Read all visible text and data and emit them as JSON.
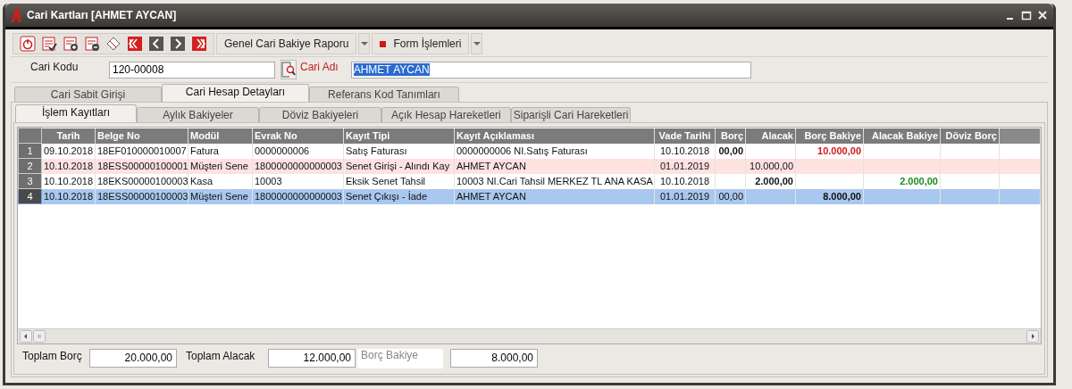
{
  "window": {
    "title": "Cari Kartları [AHMET AYCAN]"
  },
  "toolbar": {
    "icons": [
      {
        "kind": "power"
      },
      {
        "kind": "check"
      },
      {
        "kind": "add"
      },
      {
        "kind": "remove"
      },
      {
        "kind": "diamond"
      },
      {
        "kind": "first"
      },
      {
        "kind": "prev"
      },
      {
        "kind": "next"
      },
      {
        "kind": "last"
      }
    ],
    "buttons": [
      {
        "label": "Genel Cari Bakiye Raporu",
        "kind": "plain"
      },
      {
        "label": "Form İşlemleri",
        "kind": "square"
      }
    ]
  },
  "header": {
    "code_label": "Cari Kodu",
    "code_value": "120-00008",
    "name_label": "Cari Adı",
    "name_value": "AHMET AYCAN"
  },
  "tabs": [
    {
      "label": "Cari Sabit Girişi",
      "selected": false
    },
    {
      "label": "Cari Hesap Detayları",
      "selected": true
    },
    {
      "label": "Referans Kod Tanımları",
      "selected": false
    }
  ],
  "subtabs": [
    {
      "label": "İşlem Kayıtları",
      "selected": true
    },
    {
      "label": "Aylık Bakiyeler",
      "selected": false
    },
    {
      "label": "Döviz Bakiyeleri",
      "selected": false
    },
    {
      "label": "Açık Hesap Hareketleri",
      "selected": false
    },
    {
      "label": "Siparişli Cari Hareketleri",
      "selected": false
    }
  ],
  "table": {
    "columns": [
      "Tarih",
      "Belge No",
      "Modül",
      "Evrak No",
      "Kayıt Tipi",
      "Kayıt Açıklaması",
      "Vade Tarihi",
      "Borç",
      "Alacak",
      "Borç Bakiye",
      "Alacak Bakiye",
      "Döviz Borç"
    ],
    "rows": [
      {
        "number": "1",
        "selected": false,
        "kind": "normal",
        "cells": [
          "09.10.2018",
          "18EF010000010007",
          "Fatura",
          "0000000006",
          "Satış Faturası",
          "0000000006 NI.Satış Faturası",
          "10.10.2018",
          {
            "text": "00,00",
            "kind": "bold"
          },
          "",
          {
            "text": "10.000,00",
            "kind": "debit"
          },
          "",
          ""
        ]
      },
      {
        "number": "2",
        "selected": false,
        "kind": "pink",
        "cells": [
          "10.10.2018",
          "18ESS00000100001",
          "Müşteri Sene",
          "1800000000000003",
          "Senet Girişi - Alındı Kay",
          "AHMET AYCAN",
          "01.01.2019",
          "",
          "10.000,00",
          "",
          "",
          ""
        ]
      },
      {
        "number": "3",
        "selected": false,
        "kind": "normal",
        "cells": [
          "10.10.2018",
          "18EKS00000100003",
          "Kasa",
          "10003",
          "Eksik Senet Tahsil",
          "10003 NI.Cari Tahsil MERKEZ TL ANA KASA",
          "10.10.2018",
          "",
          {
            "text": "2.000,00",
            "kind": "bold"
          },
          "",
          {
            "text": "2.000,00",
            "kind": "credit"
          },
          ""
        ]
      },
      {
        "number": "4",
        "selected": true,
        "kind": "normal",
        "cells": [
          "10.10.2018",
          "18ESS00000100003",
          "Müşteri Sene",
          "1800000000000003",
          "Senet Çıkışı - İade",
          "AHMET AYCAN",
          "01.01.2019",
          "00,00",
          "",
          {
            "text": "8.000,00",
            "kind": "bold"
          },
          "",
          ""
        ]
      }
    ]
  },
  "totals": [
    {
      "label": "Toplam Borç",
      "value": "20.000,00"
    },
    {
      "label": "Toplam Alacak",
      "value": "12.000,00"
    },
    {
      "label": "Borç Bakiye",
      "value": "8.000,00",
      "kind": "boxed"
    }
  ]
}
